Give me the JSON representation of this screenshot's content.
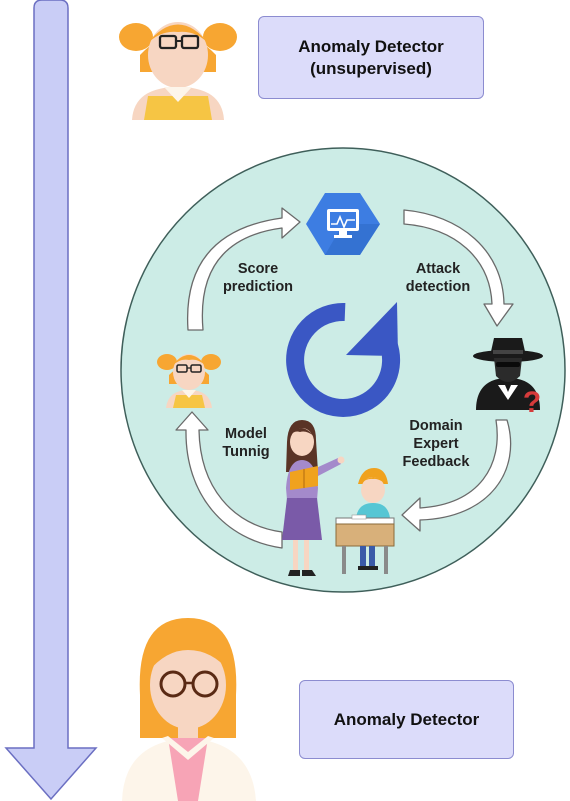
{
  "top_box": {
    "line1": "Anomaly Detector",
    "line2": "(unsupervised)"
  },
  "bottom_box": {
    "label": "Anomaly Detector"
  },
  "cycle": {
    "score_prediction": {
      "line1": "Score",
      "line2": "prediction"
    },
    "attack_detection": {
      "line1": "Attack",
      "line2": "detection"
    },
    "domain_expert_feedback": {
      "line1": "Domain",
      "line2": "Expert",
      "line3": "Feedback"
    },
    "model_tuning": {
      "line1": "Model",
      "line2": "Tunnig"
    }
  },
  "colors": {
    "timeline_arrow_fill": "#c9cdf6",
    "timeline_arrow_stroke": "#6b6fc2",
    "circle_fill": "#ccece6",
    "circle_stroke": "#3f5f5a",
    "box_fill": "#dcdcfa",
    "box_stroke": "#8c8cd0",
    "refresh_icon": "#3a57c4",
    "monitor_icon": "#3d7de2",
    "hair": "#f7a632"
  },
  "icons": [
    "child-avatar-icon",
    "adult-avatar-icon",
    "monitor-hexagon-icon",
    "refresh-icon",
    "hacker-icon",
    "teacher-student-icon"
  ]
}
